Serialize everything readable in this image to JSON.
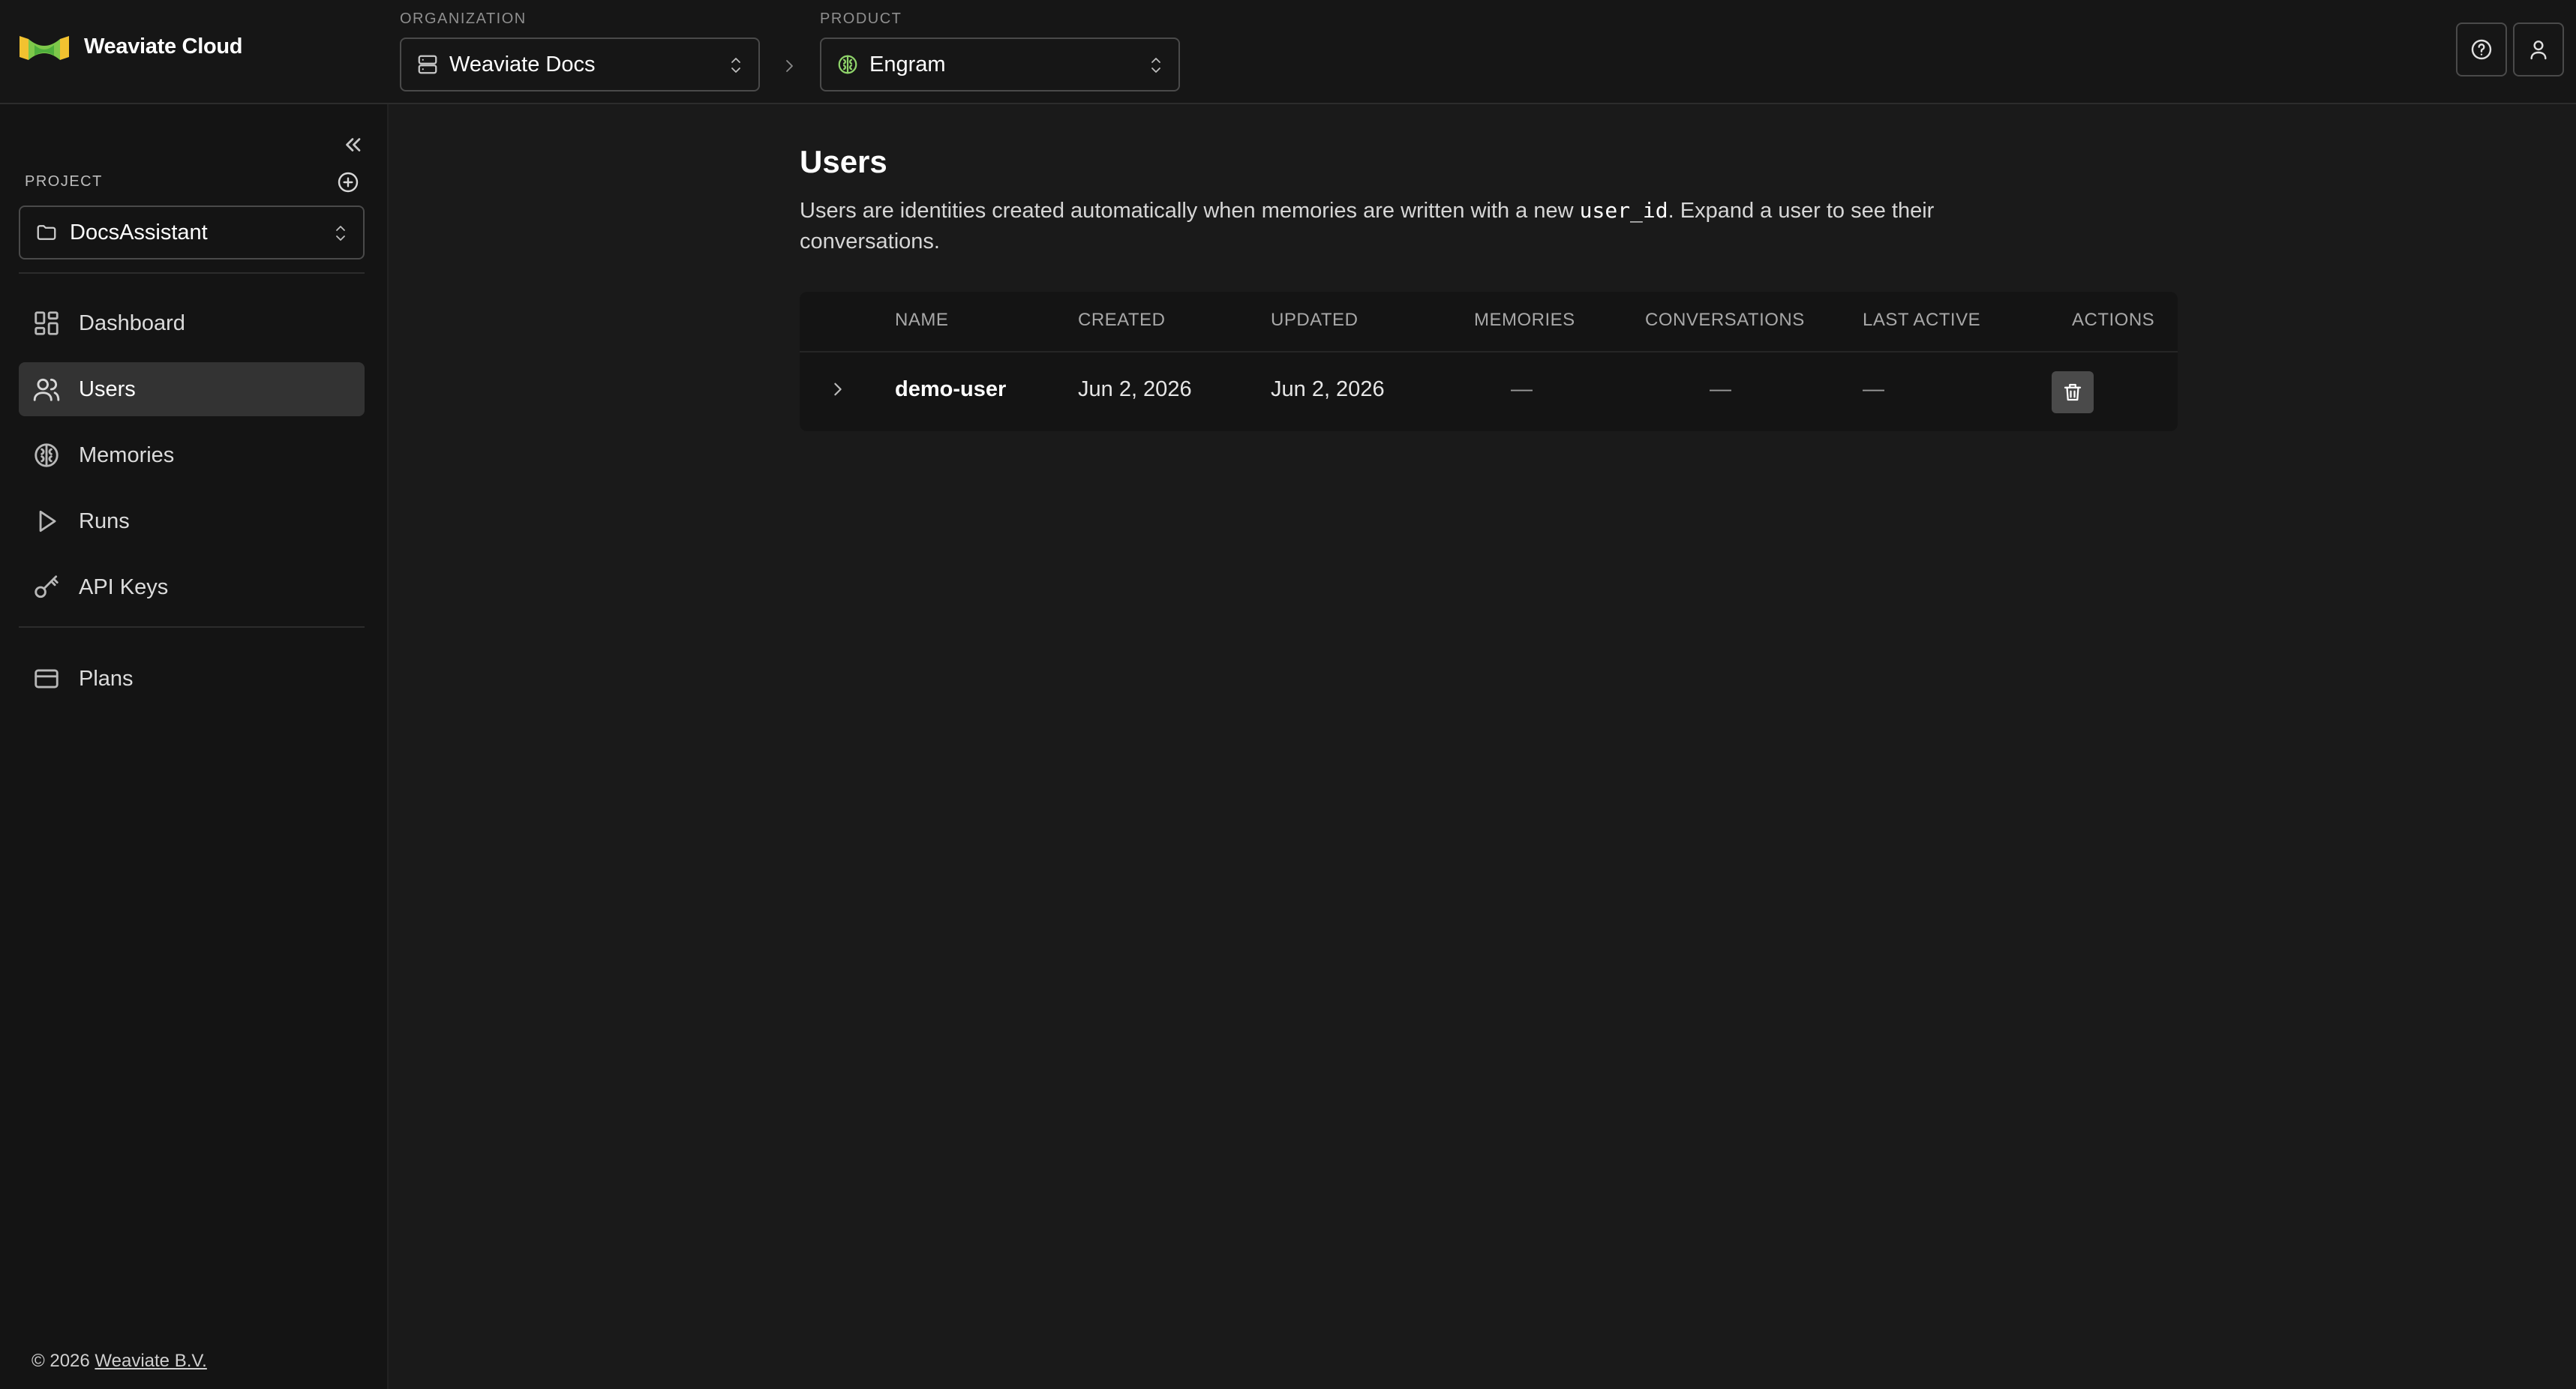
{
  "brand": {
    "name": "Weaviate Cloud",
    "logo_icon": "weaviate-logo-icon"
  },
  "header": {
    "organization": {
      "label": "ORGANIZATION",
      "value": "Weaviate Docs",
      "icon": "server-icon"
    },
    "product": {
      "label": "PRODUCT",
      "value": "Engram",
      "icon": "brain-icon",
      "icon_color": "#8fd46a"
    },
    "help_icon": "help-circle-icon",
    "account_icon": "user-icon"
  },
  "sidebar": {
    "project_label": "PROJECT",
    "project_value": "DocsAssistant",
    "items": [
      {
        "label": "Dashboard",
        "icon": "dashboard-icon"
      },
      {
        "label": "Users",
        "icon": "users-icon",
        "active": true
      },
      {
        "label": "Memories",
        "icon": "brain-icon"
      },
      {
        "label": "Runs",
        "icon": "play-icon"
      },
      {
        "label": "API Keys",
        "icon": "key-icon"
      },
      {
        "label": "Plans",
        "icon": "credit-card-icon"
      }
    ],
    "footer": {
      "copyright": "© 2026",
      "company": "Weaviate B.V."
    }
  },
  "main": {
    "title": "Users",
    "description_before": "Users are identities created automatically when memories are written with a new ",
    "description_code": "user_id",
    "description_after": ". Expand a user to see their conversations.",
    "table": {
      "columns": [
        "NAME",
        "CREATED",
        "UPDATED",
        "MEMORIES",
        "CONVERSATIONS",
        "LAST ACTIVE",
        "ACTIONS"
      ],
      "rows": [
        {
          "name": "demo-user",
          "created": "Jun 2, 2026",
          "updated": "Jun 2, 2026",
          "memories": "—",
          "conversations": "—",
          "last_active": "—"
        }
      ]
    }
  },
  "colors": {
    "accent": "#8fd46a",
    "background": "#1a1a1a",
    "sidebar": "#141414"
  }
}
